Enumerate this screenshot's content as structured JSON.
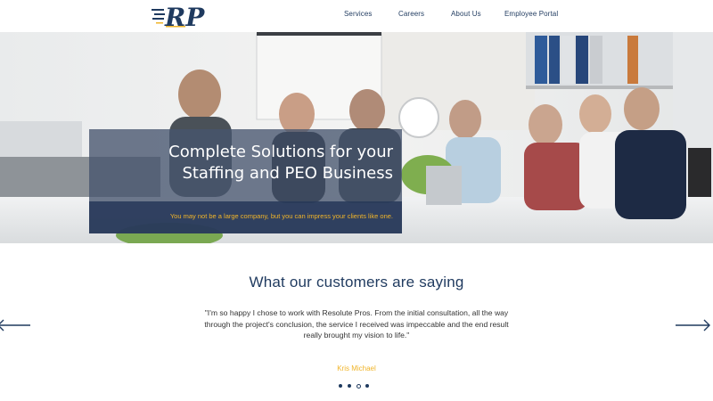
{
  "header": {
    "logo_text": "RP",
    "nav": [
      {
        "label": "Services"
      },
      {
        "label": "Careers"
      },
      {
        "label": "About Us"
      },
      {
        "label": "Employee Portal"
      }
    ]
  },
  "hero": {
    "title_line1": "Complete Solutions for your",
    "title_line2": "Staffing and PEO Business",
    "subtitle": "You may not be a large company, but you can impress your clients like one."
  },
  "testimonials": {
    "heading": "What our customers are saying",
    "quote": "\"I'm so happy I chose to work with Resolute Pros. From the initial consultation, all the way through the project's conclusion, the service I received was impeccable and the end result really brought my vision to life.\"",
    "author": "Kris Michael",
    "slide_count": 4,
    "active_slide": 3
  },
  "colors": {
    "navy": "#1f3a5f",
    "gold": "#f0b429",
    "overlay": "#46546e"
  },
  "icons": {
    "prev": "arrow-left-icon",
    "next": "arrow-right-icon"
  }
}
